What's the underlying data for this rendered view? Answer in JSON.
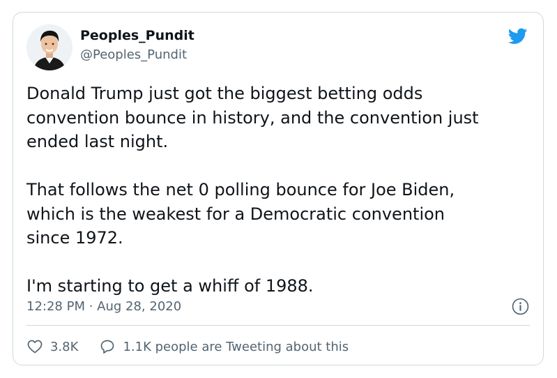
{
  "user": {
    "display_name": "Peoples_Pundit",
    "handle": "@Peoples_Pundit"
  },
  "tweet": {
    "paragraphs": [
      "Donald Trump just got the biggest betting odds\nconvention bounce in history, and the convention just\nended last night.",
      "That follows the net 0 polling bounce for Joe Biden,\nwhich is the weakest for a Democratic convention\nsince 1972.",
      "I'm starting to get a whiff of 1988."
    ],
    "timestamp": "12:28 PM · Aug 28, 2020"
  },
  "actions": {
    "likes": "3.8K",
    "replies_text": "1.1K people are Tweeting about this"
  },
  "icons": {
    "logo": "twitter-bird-icon",
    "info": "info-icon",
    "like": "heart-icon",
    "reply": "speech-bubble-icon"
  },
  "colors": {
    "brand": "#1d9bf0",
    "text": "#0f1419",
    "secondary": "#536471",
    "border": "#cfd9de"
  }
}
